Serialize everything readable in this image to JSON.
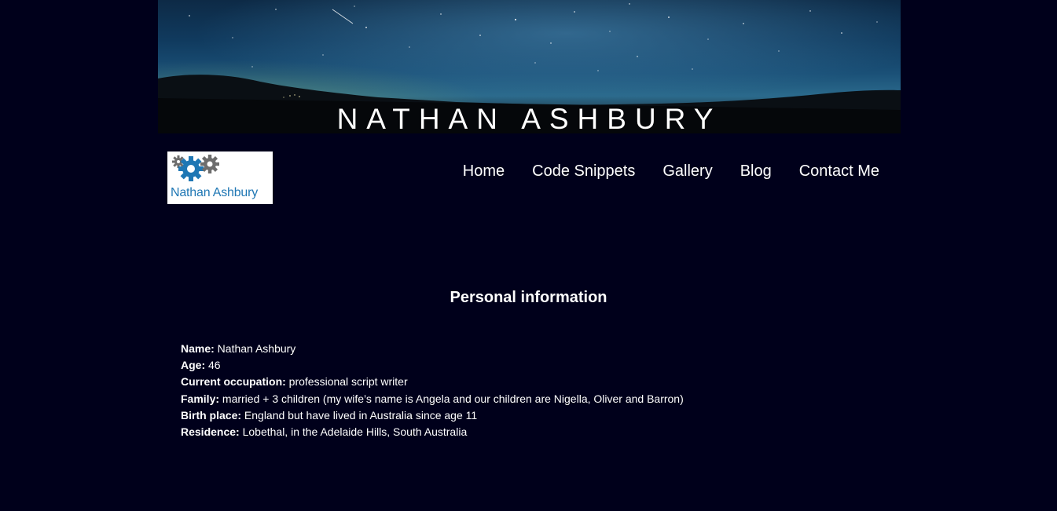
{
  "banner": {
    "title": "NATHAN ASHBURY"
  },
  "logo": {
    "text": "Nathan Ashbury",
    "icon": "gears-icon",
    "text_color": "#1f77b4"
  },
  "nav": {
    "items": [
      {
        "label": "Home"
      },
      {
        "label": "Code Snippets"
      },
      {
        "label": "Gallery"
      },
      {
        "label": "Blog"
      },
      {
        "label": "Contact Me"
      }
    ]
  },
  "main": {
    "title": "Personal information",
    "rows": [
      {
        "label": "Name:",
        "value": " Nathan Ashbury"
      },
      {
        "label": "Age:",
        "value": " 46"
      },
      {
        "label": "Current occupation:",
        "value": " professional script writer"
      },
      {
        "label": "Family:",
        "value": " married + 3 children (my wife’s name is Angela and our children are Nigella, Oliver and Barron)"
      },
      {
        "label": "Birth place:",
        "value": " England but have lived in Australia since age 11"
      },
      {
        "label": "Residence:",
        "value": " Lobethal, in the Adelaide Hills, South Australia"
      }
    ]
  },
  "colors": {
    "background": "#00001b",
    "text": "#ffffff"
  }
}
